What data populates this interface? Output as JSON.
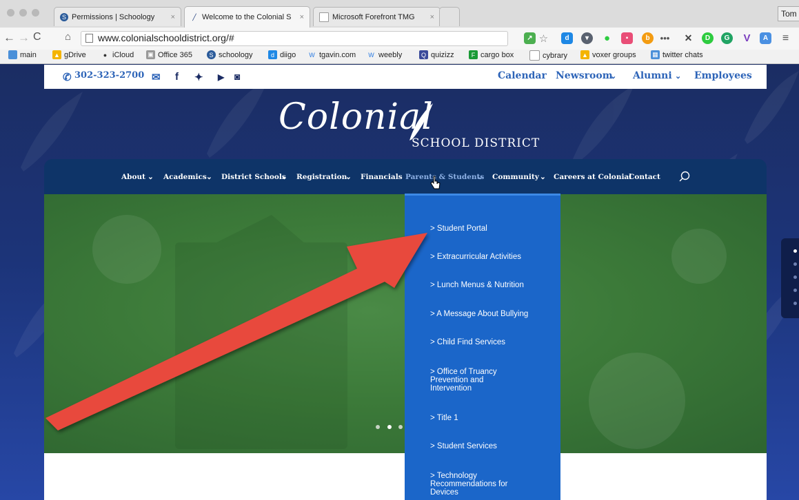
{
  "browser": {
    "tabs": [
      {
        "label": "Permissions | Schoology",
        "active": false
      },
      {
        "label": "Welcome to the Colonial S",
        "active": true
      },
      {
        "label": "Microsoft Forefront TMG",
        "active": false
      }
    ],
    "user": "Tom",
    "url": "www.colonialschooldistrict.org/#",
    "bookmarks": [
      "main",
      "gDrive",
      "iCloud",
      "Office 365",
      "schoology",
      "diigo",
      "tgavin.com",
      "weebly",
      "quizizz",
      "cargo box",
      "cybrary",
      "voxer groups",
      "twitter chats"
    ]
  },
  "site": {
    "phone": "302-323-2700",
    "top_links": [
      "Calendar",
      "Newsroom",
      "Alumni",
      "Employees"
    ],
    "logo_script": "Colonial",
    "logo_text": "SCHOOL DISTRICT",
    "nav": [
      "About",
      "Academics",
      "District Schools",
      "Registration",
      "Financials",
      "Parents & Students",
      "Community",
      "Careers at Colonial",
      "Contact"
    ],
    "dropdown": [
      "> Student Portal",
      "> Extracurricular Activities",
      "> Lunch Menus & Nutrition",
      "> A Message About Bullying",
      "> Child Find Services",
      "> Office of Truancy Prevention and Intervention",
      "> Title 1",
      "> Student Services",
      "> Technology Recommendations for Devices"
    ]
  },
  "colors": {
    "accent": "#2d64b8",
    "nav_bg": "#0e3468",
    "dropdown_bg": "#1b66c9",
    "arrow": "#e8483d"
  }
}
